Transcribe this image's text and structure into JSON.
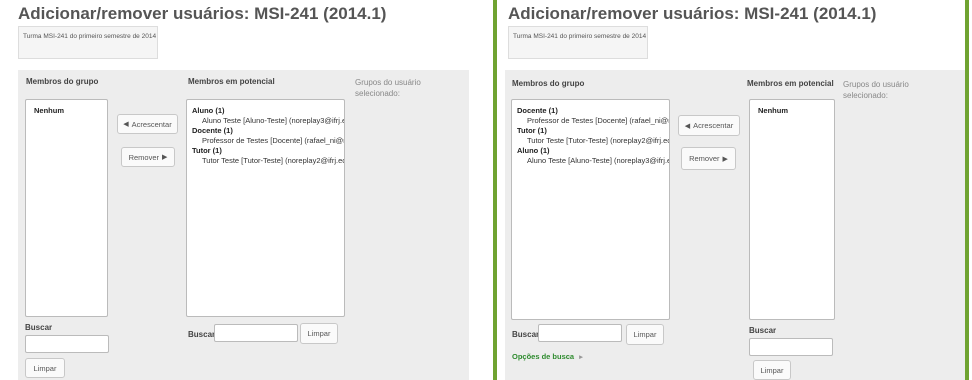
{
  "page": {
    "title": "Adicionar/remover usuários: MSI-241 (2014.1)",
    "description": "Turma MSI-241 do primeiro semestre de 2014"
  },
  "labels": {
    "group_members": "Membros do grupo",
    "potential_members": "Membros em potencial",
    "user_groups": "Grupos do usuário selecionado:",
    "search": "Buscar",
    "add": "Acrescentar",
    "remove": "Remover",
    "clear": "Limpar",
    "search_options": "Opções de busca"
  },
  "left": {
    "group_members": [
      "Nenhum"
    ],
    "potential_members": [
      {
        "group": "Aluno (1)",
        "users": [
          "Aluno Teste [Aluno-Teste] (noreplay3@ifrj.e"
        ]
      },
      {
        "group": "Docente (1)",
        "users": [
          "Professor de Testes [Docente] (rafael_ni@m"
        ]
      },
      {
        "group": "Tutor (1)",
        "users": [
          "Tutor Teste [Tutor-Teste] (noreplay2@ifrj.ec"
        ]
      }
    ]
  },
  "right": {
    "group_members": [
      {
        "group": "Docente (1)",
        "users": [
          "Professor de Testes [Docente] (rafael_ni@m"
        ]
      },
      {
        "group": "Tutor (1)",
        "users": [
          "Tutor Teste [Tutor-Teste] (noreplay2@ifrj.ec"
        ]
      },
      {
        "group": "Aluno (1)",
        "users": [
          "Aluno Teste [Aluno-Teste] (noreplay3@ifrj.e"
        ]
      }
    ],
    "potential_members": [
      "Nenhum"
    ]
  },
  "icons": {
    "add": "left-triangle-icon",
    "remove": "right-triangle-icon",
    "options": "caret-right-icon"
  },
  "colors": {
    "accent_bar": "#6fa331",
    "link": "#2e8b2e",
    "panel_gray": "#ededed"
  }
}
